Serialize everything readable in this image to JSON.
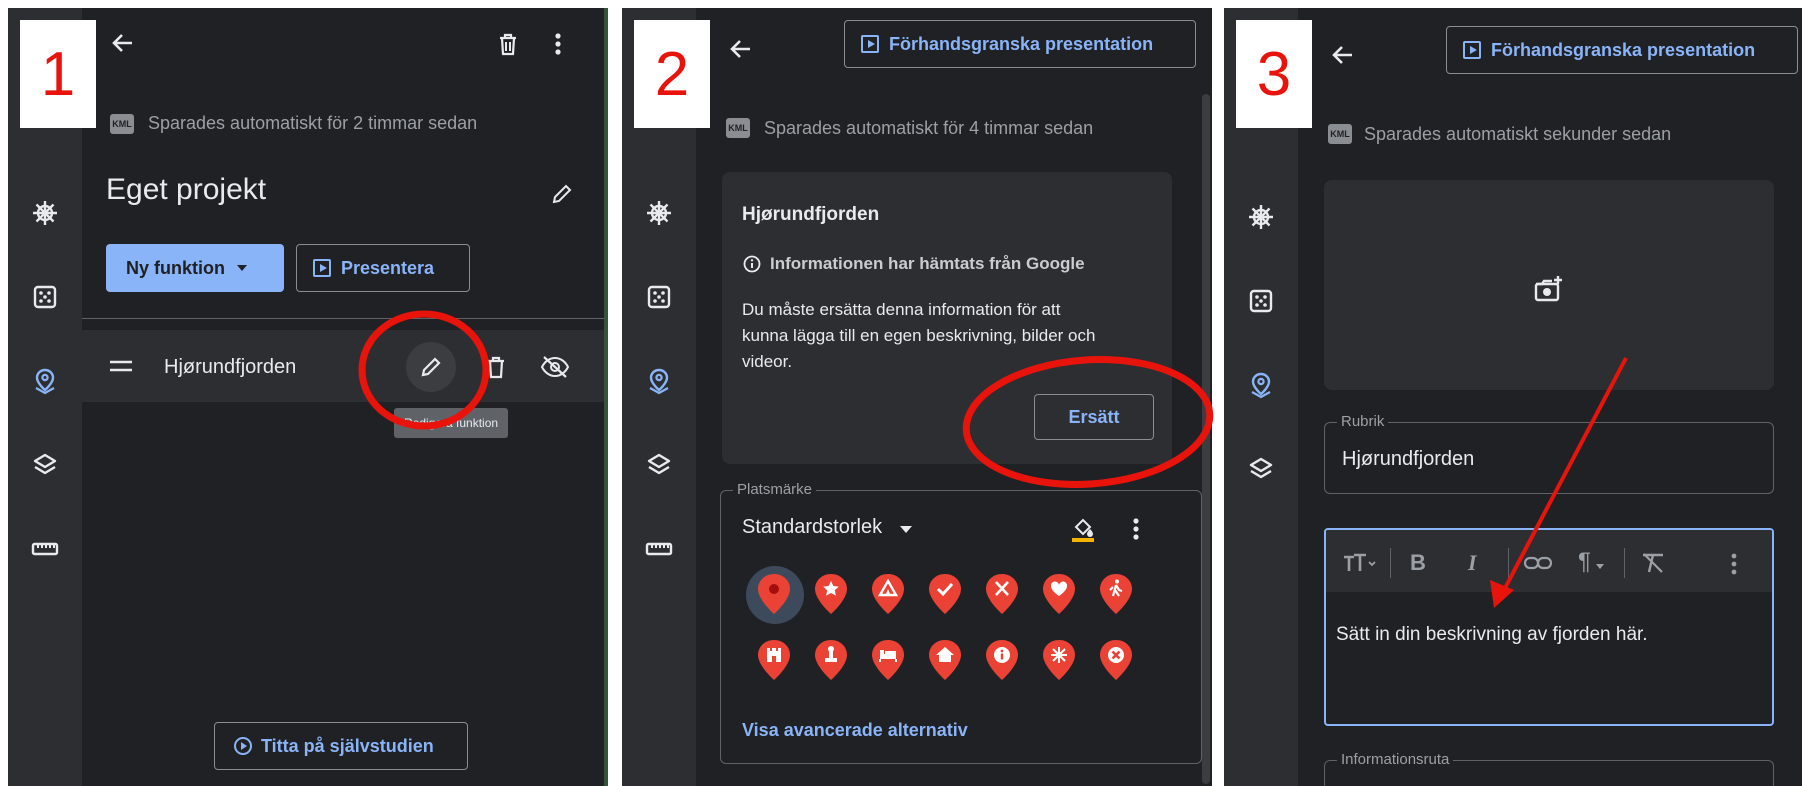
{
  "panel1": {
    "number": "1",
    "autosave": "Sparades automatiskt för 2 timmar sedan",
    "kml": "KML",
    "project_title": "Eget projekt",
    "new_feature_label": "Ny funktion",
    "present_label": "Presentera",
    "feature_name": "Hjørundfjorden",
    "tooltip": "Redigera funktion",
    "tutorial_label": "Titta på självstudien"
  },
  "panel2": {
    "number": "2",
    "preview_label": "Förhandsgranska presentation",
    "autosave": "Sparades automatiskt för 4 timmar sedan",
    "kml": "KML",
    "card_title": "Hjørundfjorden",
    "info_source": "Informationen har hämtats från Google",
    "info_text_1": "Du måste ersätta denna information för att",
    "info_text_2": "kunna lägga till en egen beskrivning, bilder och",
    "info_text_3": "videor.",
    "replace_label": "Ersätt",
    "marker_legend": "Platsmärke",
    "marker_size": "Standardstorlek",
    "advanced_label": "Visa avancerade alternativ",
    "pin_icons": [
      "pin-dot",
      "pin-star",
      "pin-tent",
      "pin-check",
      "pin-utensils",
      "pin-heart",
      "pin-hiker",
      "pin-castle",
      "pin-monument",
      "pin-bed",
      "pin-home",
      "pin-info",
      "pin-flower",
      "pin-x"
    ]
  },
  "panel3": {
    "number": "3",
    "preview_label": "Förhandsgranska presentation",
    "autosave": "Sparades automatiskt sekunder sedan",
    "kml": "KML",
    "rubrik_legend": "Rubrik",
    "rubrik_value": "Hjørundfjorden",
    "description_text": "Sätt in din beskrivning av fjorden här.",
    "info_legend": "Informationsruta"
  },
  "colors": {
    "panel_bg": "#202124",
    "rail_bg": "#2d2e31",
    "accent_blue": "#8ab4f8",
    "pin_red": "#ea4335",
    "annotation_red": "#e8140c"
  }
}
